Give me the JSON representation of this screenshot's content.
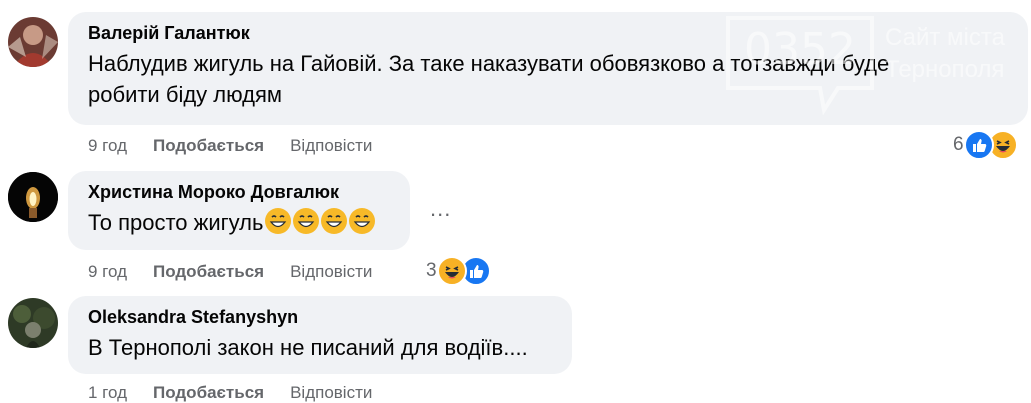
{
  "comments": [
    {
      "author": "Валерій Галантюк",
      "text_line1": "Наблудив жигуль на Гайовій. За таке наказувати обовязково а тотзавжди буде",
      "text_line2": "робити біду людям",
      "time": "9 год",
      "like_label": "Подобається",
      "reply_label": "Відповісти",
      "reaction_count": "6",
      "reactions": [
        "like-icon",
        "haha-icon"
      ]
    },
    {
      "author": "Христина Мороко Довгалюк",
      "text": "То просто жигуль",
      "emoji_count": 4,
      "time": "9 год",
      "like_label": "Подобається",
      "reply_label": "Відповісти",
      "reaction_count": "3",
      "reactions": [
        "haha-icon",
        "like-icon"
      ],
      "more_label": "..."
    },
    {
      "author": "Oleksandra Stefanyshyn",
      "text": "В Тернополі закон не писаний для водіїв....",
      "time": "1 год",
      "like_label": "Подобається",
      "reply_label": "Відповісти"
    }
  ],
  "watermark": {
    "number": "0352",
    "line1": "Сайт міста",
    "line2": "Тернополя"
  },
  "colors": {
    "bubble": "#f0f2f5",
    "meta": "#65676b",
    "like": "#1877f2",
    "haha": "#f7b125"
  }
}
